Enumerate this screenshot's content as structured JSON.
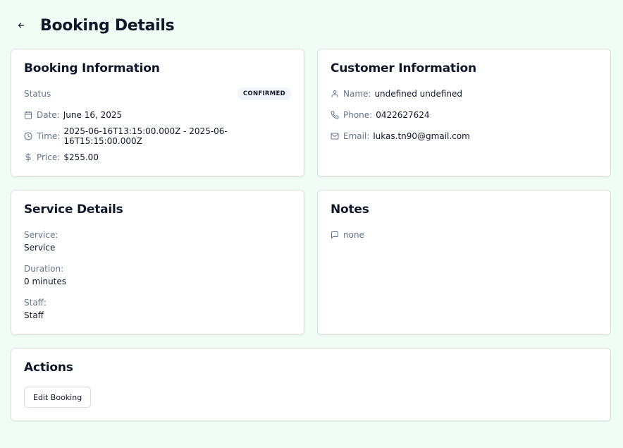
{
  "header": {
    "title": "Booking Details"
  },
  "booking": {
    "title": "Booking Information",
    "status_label": "Status",
    "status_badge": "CONFIRMED",
    "date_label": "Date:",
    "date_value": "June 16, 2025",
    "time_label": "Time:",
    "time_value": "2025-06-16T13:15:00.000Z - 2025-06-16T15:15:00.000Z",
    "price_label": "Price:",
    "price_value": "$255.00"
  },
  "customer": {
    "title": "Customer Information",
    "name_label": "Name:",
    "name_value": "undefined undefined",
    "phone_label": "Phone:",
    "phone_value": "0422627624",
    "email_label": "Email:",
    "email_value": "lukas.tn90@gmail.com"
  },
  "service": {
    "title": "Service Details",
    "service_label": "Service:",
    "service_value": "Service",
    "duration_label": "Duration:",
    "duration_value": "0 minutes",
    "staff_label": "Staff:",
    "staff_value": "Staff"
  },
  "notes": {
    "title": "Notes",
    "value": "none"
  },
  "actions": {
    "title": "Actions",
    "edit_label": "Edit Booking"
  },
  "colors": {
    "background": "#f0fdf4",
    "card": "#ffffff",
    "muted_text": "#64748b",
    "badge_bg": "#f1f5f9"
  }
}
